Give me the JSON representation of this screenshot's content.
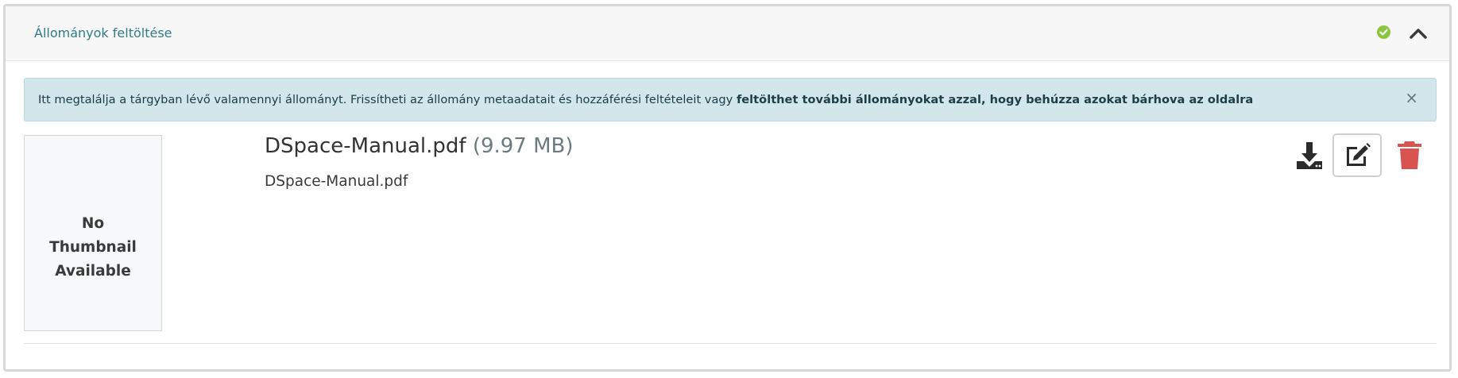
{
  "section": {
    "title": "Állományok feltöltése",
    "status_icon": "check-circle-icon",
    "status_color": "#8cc63f",
    "collapse_icon": "chevron-up-icon"
  },
  "alert": {
    "text_plain": "Itt megtalálja a tárgyban lévő valamennyi állományt. Frissítheti az állomány metaadatait és hozzáférési feltételeit vagy ",
    "text_bold": "feltölthet további állományokat azzal, hogy behúzza azokat bárhova az oldalra",
    "close_symbol": "×",
    "background_color": "#d2e6ec"
  },
  "file": {
    "thumbnail_text": "No Thumbnail Available",
    "name": "DSpace-Manual.pdf",
    "size": "(9.97 MB)",
    "description": "DSpace-Manual.pdf"
  },
  "actions": {
    "download_icon": "download-icon",
    "edit_icon": "edit-icon",
    "delete_icon": "trash-icon",
    "delete_color": "#d9534f"
  }
}
